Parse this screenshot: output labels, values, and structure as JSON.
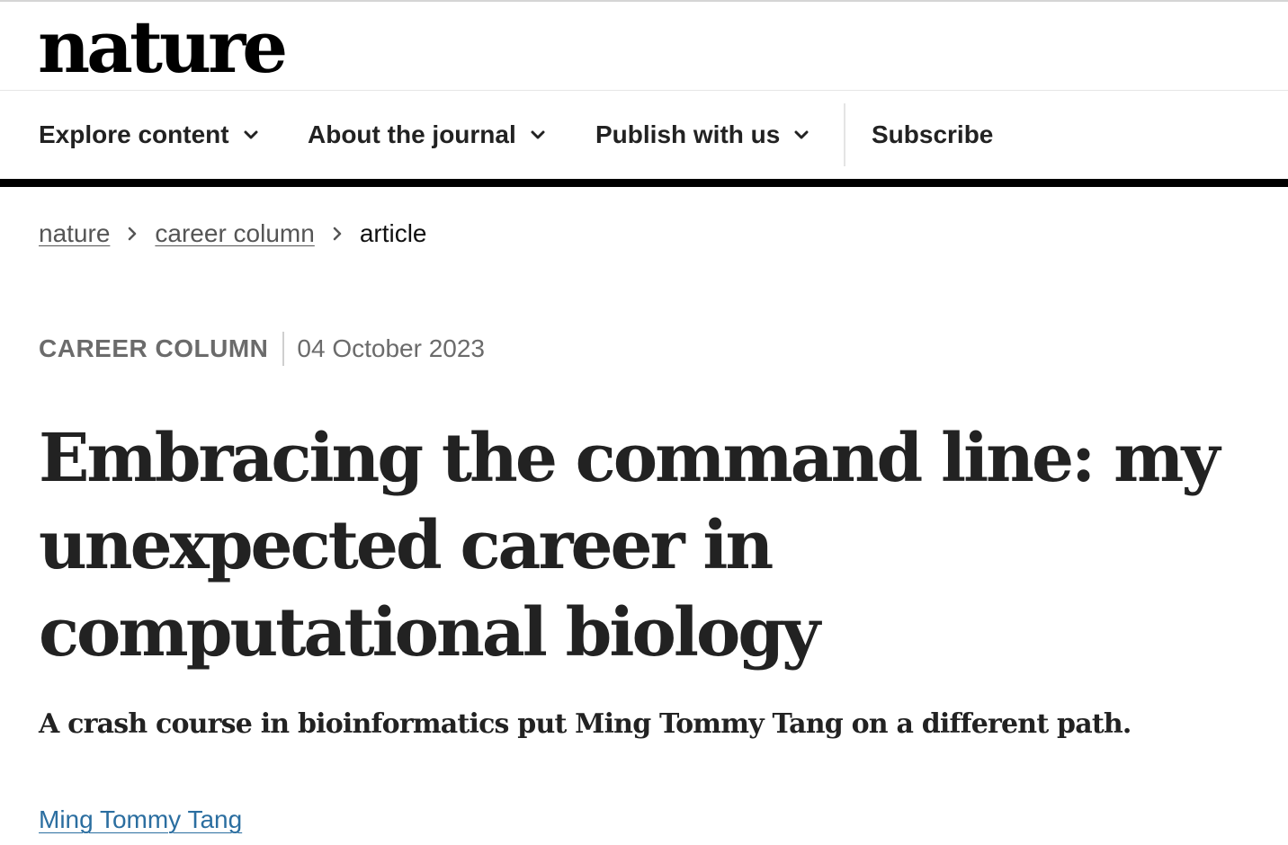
{
  "header": {
    "logo_text": "nature"
  },
  "nav": {
    "items": [
      {
        "label": "Explore content",
        "icon": "chevron-down-icon"
      },
      {
        "label": "About the journal",
        "icon": "chevron-down-icon"
      },
      {
        "label": "Publish with us",
        "icon": "chevron-down-icon"
      },
      {
        "label": "Subscribe"
      }
    ]
  },
  "breadcrumb": {
    "items": [
      "nature",
      "career column",
      "article"
    ],
    "separator_icon": "chevron-right-icon"
  },
  "article": {
    "type": "CAREER COLUMN",
    "date": "04 October 2023",
    "title": "Embracing the command line: my unexpected career in computational biology",
    "standfirst": "A crash course in bioinformatics put Ming Tommy Tang on a different path.",
    "author": "Ming Tommy Tang"
  },
  "colors": {
    "text": "#222222",
    "link": "#2b6ea0",
    "muted": "#6b6b6b",
    "rule": "#000000"
  }
}
